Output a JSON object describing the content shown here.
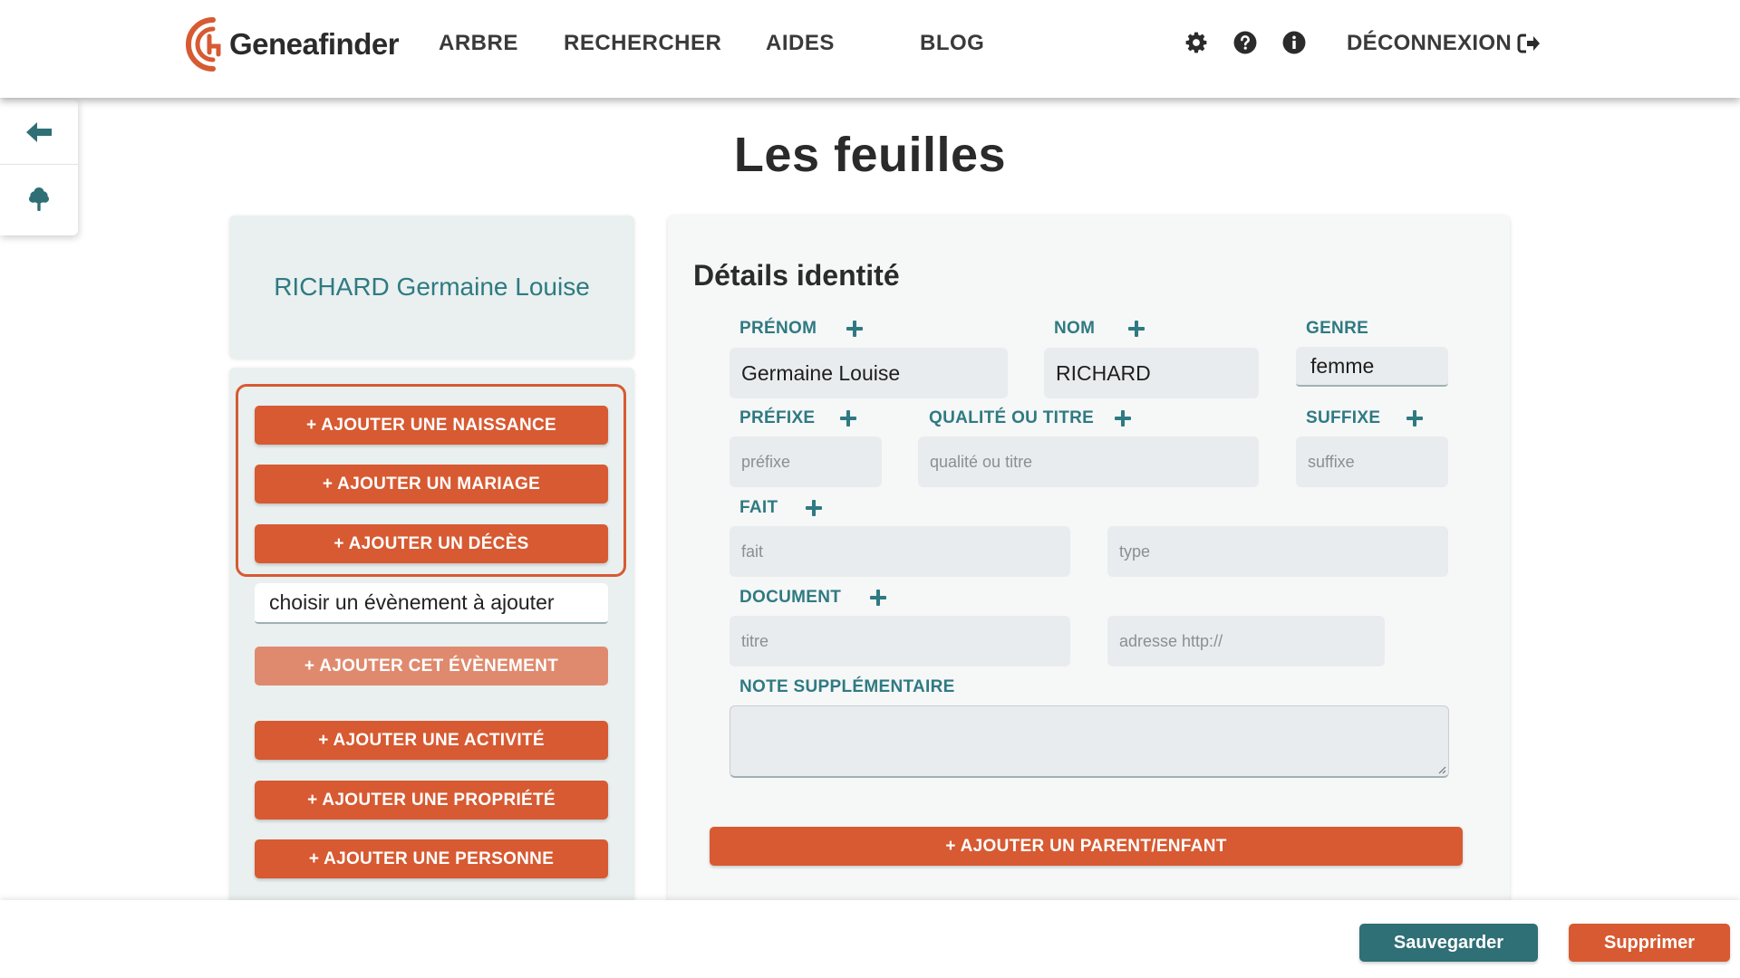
{
  "brand": {
    "name": "Geneafinder",
    "accent": "#d75a32",
    "teal": "#2f7a82"
  },
  "nav": {
    "items": [
      "ARBRE",
      "RECHERCHER",
      "AIDES",
      "BLOG"
    ],
    "icons": [
      "gear-icon",
      "question-circle-icon",
      "info-circle-icon"
    ],
    "logout": "DÉCONNEXION"
  },
  "sidetools": {
    "icons": [
      "arrow-left-icon",
      "tree-icon"
    ]
  },
  "page": {
    "title": "Les feuilles"
  },
  "person": {
    "name": "RICHARD Germaine Louise"
  },
  "actions": {
    "add_birth": "+ AJOUTER UNE NAISSANCE",
    "add_marriage": "+ AJOUTER UN MARIAGE",
    "add_death": "+ AJOUTER UN DÉCÈS",
    "event_select": "choisir un évènement à ajouter",
    "add_event": "+ AJOUTER CET ÉVÈNEMENT",
    "add_activity": "+ AJOUTER UNE ACTIVITÉ",
    "add_property": "+ AJOUTER UNE PROPRIÉTÉ",
    "add_person": "+ AJOUTER UNE PERSONNE"
  },
  "identity": {
    "title": "Détails identité",
    "firstname": {
      "label": "PRÉNOM",
      "value": "Germaine Louise"
    },
    "lastname": {
      "label": "NOM",
      "value": "RICHARD"
    },
    "gender": {
      "label": "GENRE",
      "value": "femme"
    },
    "prefix": {
      "label": "PRÉFIXE",
      "placeholder": "préfixe"
    },
    "quality": {
      "label": "QUALITÉ OU TITRE",
      "placeholder": "qualité ou titre"
    },
    "suffix": {
      "label": "SUFFIXE",
      "placeholder": "suffixe"
    },
    "fact": {
      "label": "FAIT",
      "placeholder": "fait",
      "type_placeholder": "type"
    },
    "document": {
      "label": "DOCUMENT",
      "title_placeholder": "titre",
      "url_placeholder": "adresse http://"
    },
    "note": {
      "label": "NOTE SUPPLÉMENTAIRE",
      "value": ""
    },
    "add_parent_child": "+ AJOUTER UN PARENT/ENFANT"
  },
  "footer": {
    "save": "Sauvegarder",
    "delete": "Supprimer"
  }
}
